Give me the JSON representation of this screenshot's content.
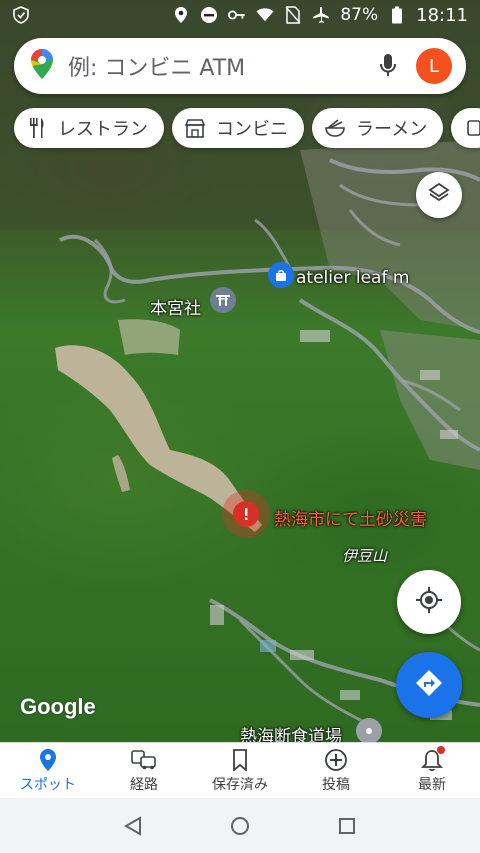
{
  "status_bar": {
    "battery": "87%",
    "time": "18:11",
    "icons": [
      "shield-icon",
      "location-icon",
      "dnd-icon",
      "key-icon",
      "wifi-icon",
      "no-sim-icon",
      "airplane-icon",
      "battery-icon"
    ]
  },
  "search": {
    "placeholder": "例: コンビニ ATM",
    "avatar_letter": "L",
    "avatar_color": "#f4511e"
  },
  "chips": [
    {
      "label": "レストラン",
      "icon": "restaurant-icon"
    },
    {
      "label": "コンビニ",
      "icon": "store-icon"
    },
    {
      "label": "ラーメン",
      "icon": "ramen-icon"
    }
  ],
  "map": {
    "places": {
      "shop": "atelier leaf m",
      "shrine": "本宮社",
      "alert": "熱海市にて土砂災害",
      "area": "伊豆山",
      "restaurant": "熱海断食道場"
    },
    "attribution": "Google"
  },
  "bottom_nav": [
    {
      "label": "スポット",
      "icon": "explore-pin-icon",
      "active": true
    },
    {
      "label": "経路",
      "icon": "commute-icon",
      "active": false
    },
    {
      "label": "保存済み",
      "icon": "bookmark-icon",
      "active": false
    },
    {
      "label": "投稿",
      "icon": "add-circle-icon",
      "active": false
    },
    {
      "label": "最新",
      "icon": "bell-icon",
      "active": false
    }
  ],
  "colors": {
    "accent": "#1a73e8",
    "alert": "#d93025"
  }
}
